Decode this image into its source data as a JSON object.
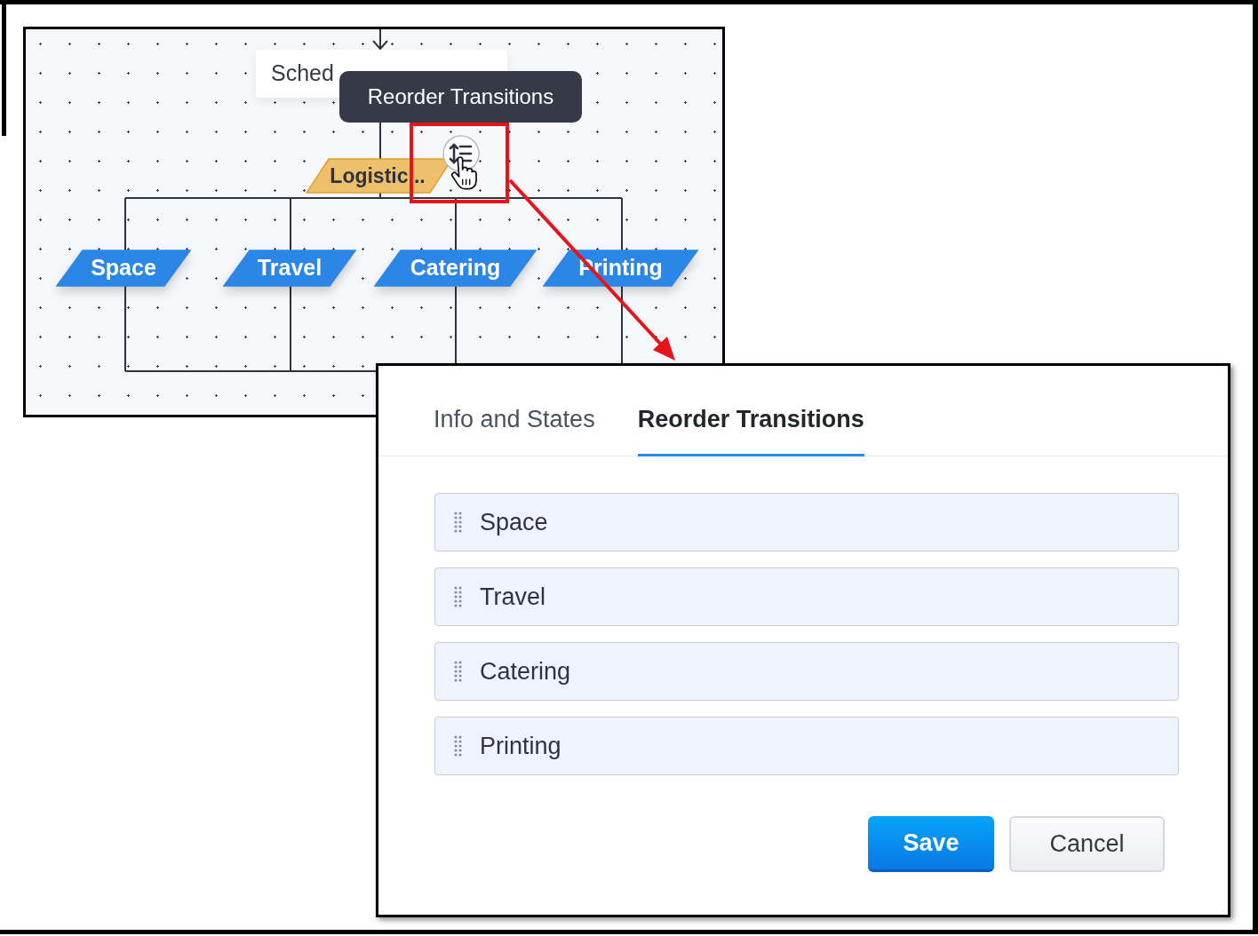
{
  "canvas": {
    "start_node": {
      "label": "Sched"
    },
    "group_node": {
      "label": "Logistic..."
    },
    "branch_nodes": [
      {
        "label": "Space"
      },
      {
        "label": "Travel"
      },
      {
        "label": "Catering"
      },
      {
        "label": "Printing"
      }
    ]
  },
  "tooltip": {
    "text": "Reorder Transitions"
  },
  "dialog": {
    "tabs": [
      {
        "label": "Info and States",
        "selected": false
      },
      {
        "label": "Reorder Transitions",
        "selected": true
      }
    ],
    "items": [
      {
        "label": "Space"
      },
      {
        "label": "Travel"
      },
      {
        "label": "Catering"
      },
      {
        "label": "Printing"
      }
    ],
    "buttons": [
      {
        "label": "Save",
        "kind": "primary"
      },
      {
        "label": "Cancel",
        "kind": "secondary"
      }
    ]
  }
}
